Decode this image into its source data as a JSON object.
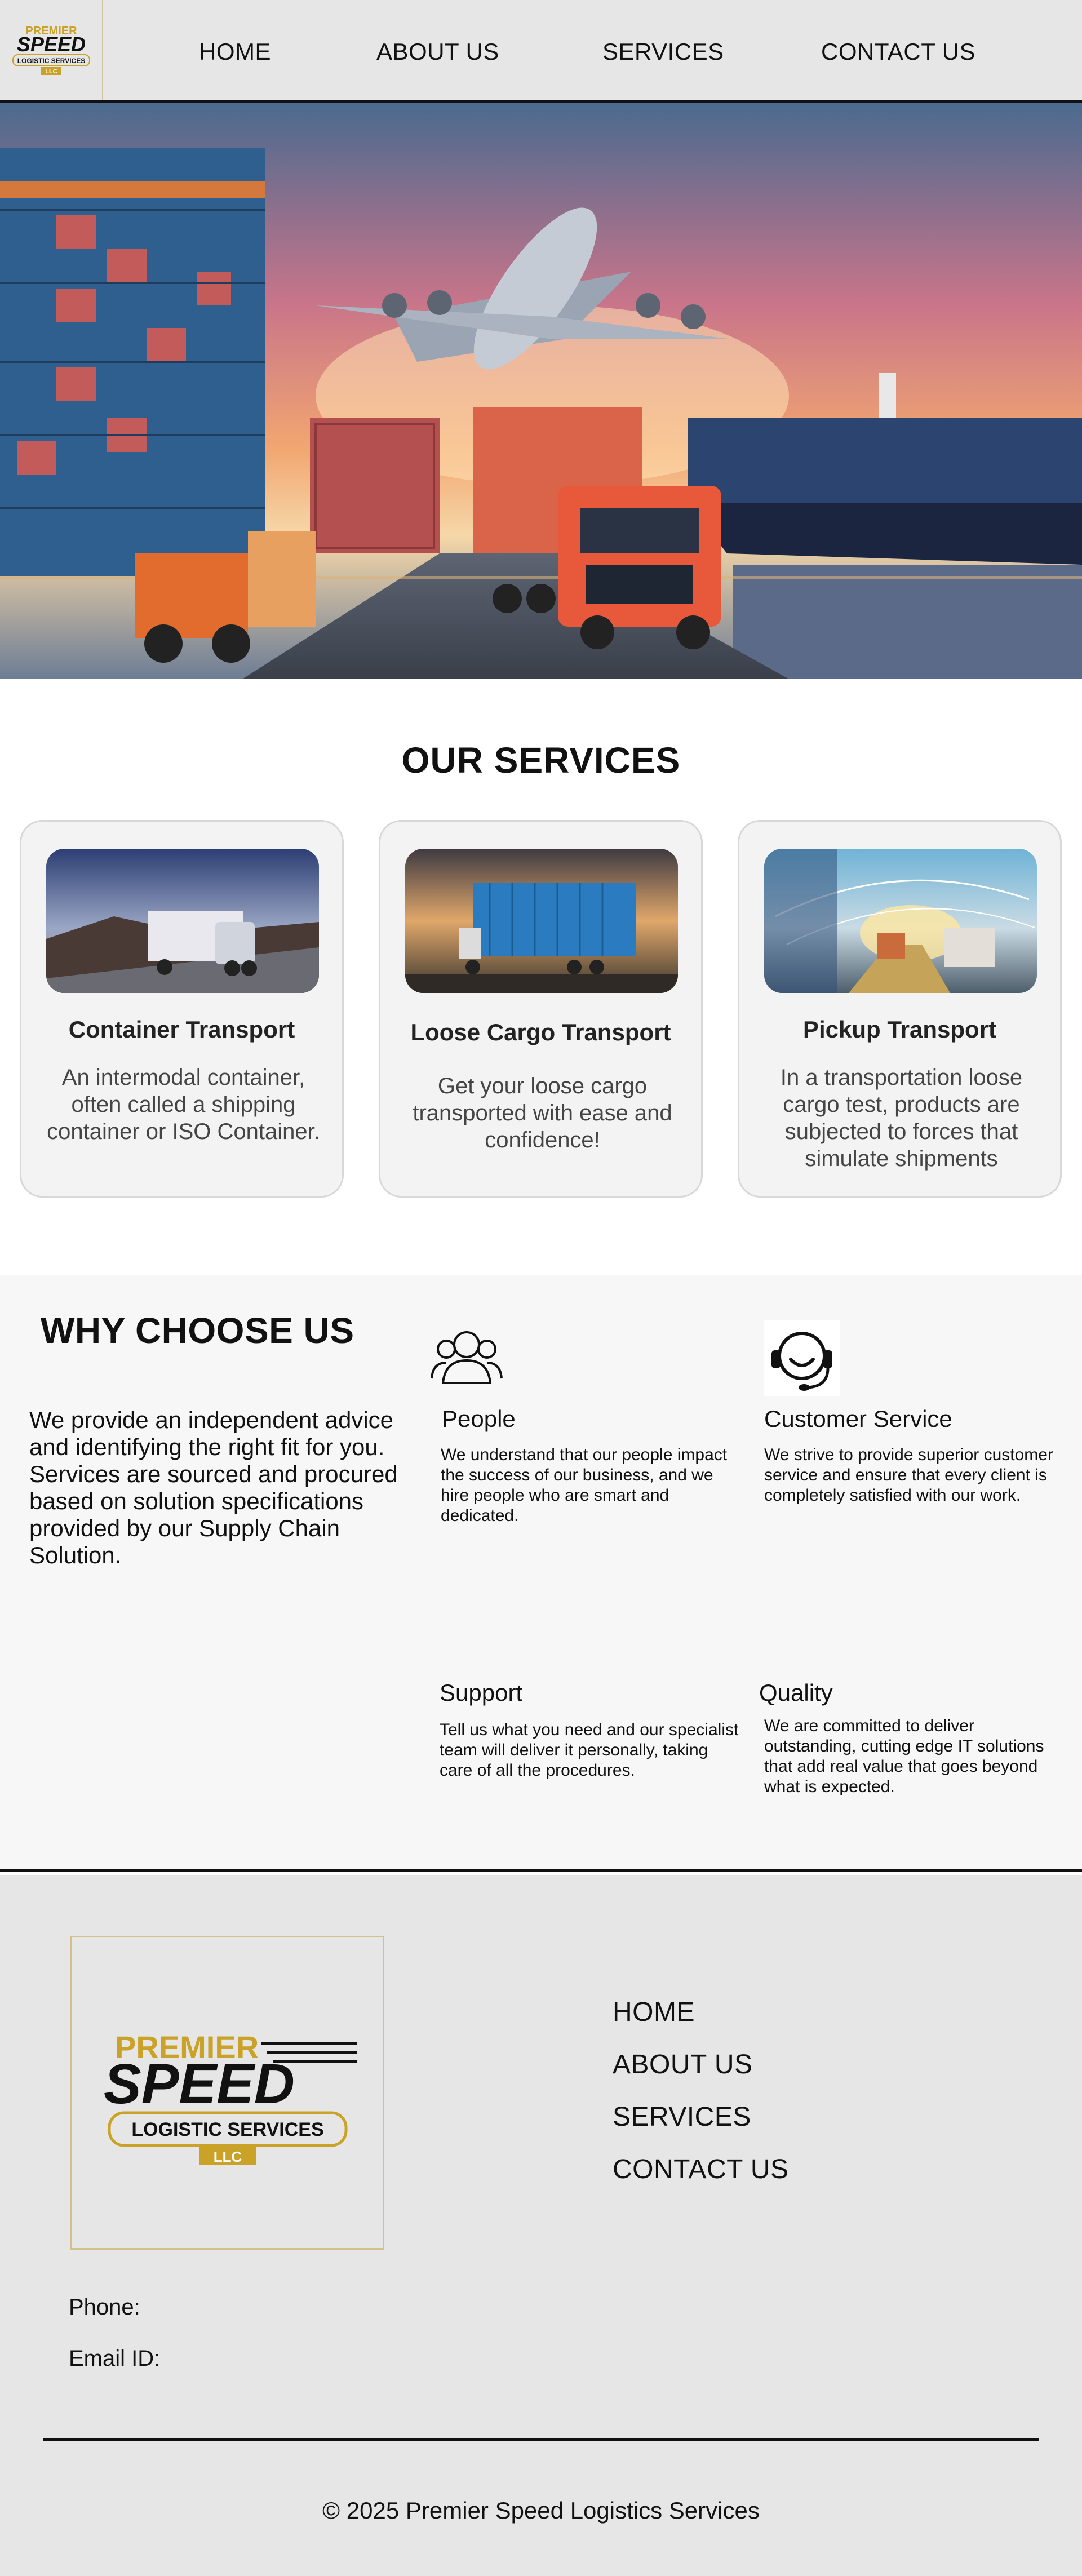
{
  "header": {
    "logo": {
      "line1": "PREMIER",
      "line2": "SPEED",
      "line3": "LOGISTIC SERVICES",
      "line4": "LLC"
    },
    "nav": [
      "HOME",
      "ABOUT US",
      "SERVICES",
      "CONTACT US"
    ]
  },
  "services": {
    "title": "OUR SERVICES",
    "cards": [
      {
        "title": "Container Transport",
        "text": "An intermodal container, often called a shipping container or ISO Container."
      },
      {
        "title": "Loose Cargo Transport",
        "text": "Get your loose cargo transported with ease and confidence!"
      },
      {
        "title": "Pickup Transport",
        "text": "In a transportation loose cargo test, products are subjected to forces that simulate shipments"
      }
    ]
  },
  "why": {
    "title": "WHY CHOOSE US",
    "intro": "We provide an independent advice and identifying the right fit for you. Services are sourced and procured based on solution specifications provided by our Supply Chain Solution.",
    "features": [
      {
        "title": "People",
        "icon": "people-icon",
        "text": "We understand that our people impact the success of our business, and we hire people who are smart and dedicated."
      },
      {
        "title": "Customer Service",
        "icon": "headset-icon",
        "text": "We strive to provide superior customer service and ensure that every client is completely satisfied with our work."
      },
      {
        "title": "Support",
        "text": "Tell us what you need and our specialist team will deliver it personally, taking care of all the procedures."
      },
      {
        "title": "Quality",
        "text": "We are committed to deliver outstanding, cutting edge IT solutions that add real value that goes beyond what is expected."
      }
    ]
  },
  "footer": {
    "nav": [
      "HOME",
      "ABOUT US",
      "SERVICES",
      "CONTACT US"
    ],
    "phone_label": "Phone:",
    "email_label": "Email ID:",
    "copyright": "© 2025 Premier Speed Logistics Services"
  },
  "colors": {
    "gold": "#c9a227",
    "black": "#111111",
    "header_bg": "#e6e6e6"
  }
}
